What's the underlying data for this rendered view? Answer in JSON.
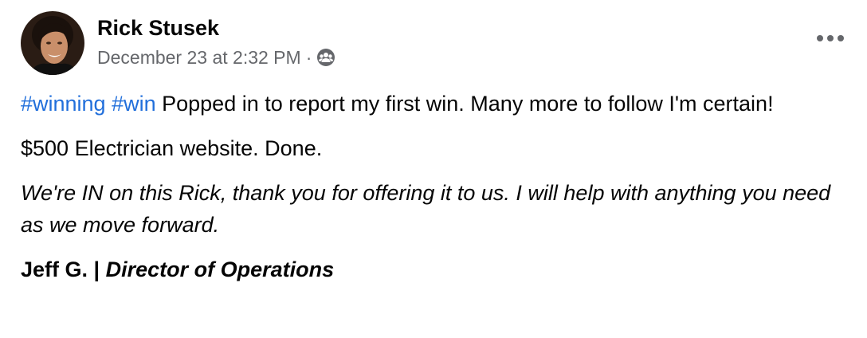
{
  "post": {
    "author": "Rick Stusek",
    "timestamp": "December 23 at 2:32 PM",
    "separator": "·",
    "audience_icon": "group-icon",
    "more_icon": "more-options-icon",
    "hashtags": [
      "#winning",
      "#win"
    ],
    "line1_text": " Popped in to report my first win. Many more to follow I'm certain!",
    "line2": "$500 Electrician website. Done.",
    "quote": "We're IN on this Rick, thank you for offering it to us. I will help with anything you need as we move forward.",
    "signature_name": "Jeff G. | ",
    "signature_title": "Director of Operations"
  },
  "colors": {
    "hashtag": "#216fdb",
    "secondary_text": "#65676b",
    "primary_text": "#050505"
  }
}
